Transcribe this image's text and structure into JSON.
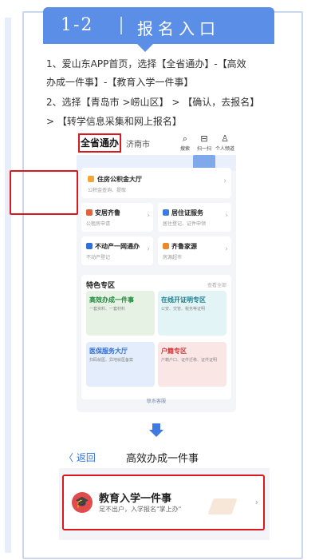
{
  "colors": {
    "accent": "#5b8ee6",
    "highlight": "#d8191e",
    "link": "#2f73e0"
  },
  "header": {
    "number": "1-2",
    "title": "报名入口"
  },
  "instructions": [
    "1、爱山东APP首页，选择【全省通办】-【高效",
    "办成一件事】-【教育入学一件事】",
    "2、选择【青岛市 >崂山区】 > 【确认，去报名】",
    "> 【转学信息采集和网上报名】"
  ],
  "app": {
    "tabs": {
      "active": "全省通办",
      "city": "济南市"
    },
    "top_icons": [
      {
        "icon": "search-icon",
        "label": "搜索"
      },
      {
        "icon": "scan-icon",
        "label": "扫一扫"
      },
      {
        "icon": "user-icon",
        "label": "个人频道"
      }
    ],
    "cards": {
      "housing_fund": {
        "title": "住房公积金大厅",
        "sub": "公积金查询、提取"
      },
      "anju": {
        "title": "安居齐鲁",
        "sub": "公租房申请"
      },
      "residence": {
        "title": "居住证服务",
        "sub": "居住登记、证件申领"
      },
      "realestate": {
        "title": "不动产一网通办",
        "sub": "不动产登记"
      },
      "family": {
        "title": "齐鲁家源",
        "sub": "房源超市"
      }
    },
    "special": {
      "title": "特色专区",
      "more": "查看全部",
      "tiles": [
        {
          "title": "高效办成一件事",
          "sub": "一套资料、一套材料"
        },
        {
          "title": "在线开证明专区",
          "sub": "公安、交管、税务等证明"
        },
        {
          "title": "医保服务大厅",
          "sub": "扫码就医、异地就医备案"
        },
        {
          "title": "户籍专区",
          "sub": "户籍户口、证件迁移、证件证明"
        }
      ]
    },
    "customer_service": "联系客服"
  },
  "page": {
    "back": "〈 返回",
    "title": "高效办成一件事"
  },
  "edu": {
    "title": "教育入学一件事",
    "sub": "足不出户，入学报名\"掌上办\""
  }
}
